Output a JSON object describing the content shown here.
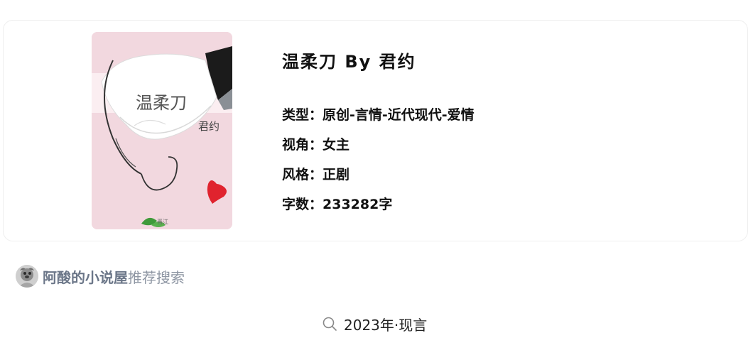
{
  "book": {
    "cover_title": "温柔刀",
    "cover_author": "君约",
    "cover_mark": "晋江",
    "title": "温柔刀 By 君约",
    "genre_label": "类型：",
    "genre": "原创-言情-近代现代-爱情",
    "perspective_label": "视角：",
    "perspective": "女主",
    "style_label": "风格：",
    "style": "正剧",
    "wordcount_label": "字数：",
    "wordcount": "233282字"
  },
  "source": {
    "site_name": "阿酸的小说屋",
    "suffix": "推荐搜索"
  },
  "search": {
    "icon": "search-icon",
    "query": "2023年·现言"
  },
  "colors": {
    "cover_bg": "#f2d8df",
    "heart": "#e0232e",
    "site_name": "#6b7688",
    "recommend": "#8e96a3"
  }
}
